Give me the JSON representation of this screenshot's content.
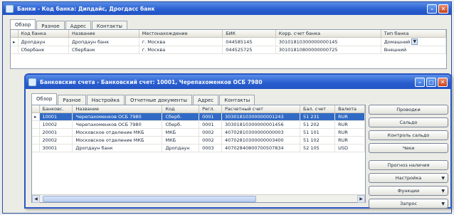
{
  "outer_window": {
    "title": "Банки - Код банка: Дипдайс, Дрогдасс банк",
    "tabs": [
      "Обзор",
      "Разное",
      "Адрес",
      "Контакты"
    ],
    "grid": {
      "columns": [
        "Код банка",
        "Название",
        "Местонахождение",
        "БИК",
        "Корр. счет банка",
        "Тип банка"
      ],
      "rows": [
        [
          "Дропдаун",
          "Дропдаун банк",
          "г. Москва",
          "044585145",
          "30101810300000000145",
          "Домашний"
        ],
        [
          "Сбербанк",
          "Сбербанк",
          "г. Москва",
          "044525725",
          "30101810800000000725",
          "Внешний"
        ]
      ]
    }
  },
  "inner_window": {
    "title": "Банковские счета - Банковский счет: 10001, Черепахоменков ОСБ 7980",
    "tabs": [
      "Обзор",
      "Разное",
      "Настройка",
      "Отчетные документы",
      "Адрес",
      "Контакты"
    ],
    "grid": {
      "columns": [
        "Банковс.",
        "Название",
        "Код",
        "Регл.",
        "Расчетный счет",
        "Бал. счет",
        "Валюта"
      ],
      "rows": [
        [
          "10001",
          "Черепахоменков ОСБ 7980",
          "Сберб.",
          "0001",
          "30301810300000001243",
          "51 231",
          "RUR"
        ],
        [
          "10002",
          "Черепахоменков ОСБ 7980",
          "Сберб.",
          "0001",
          "30301810300000001456",
          "51 202",
          "RUR"
        ],
        [
          "20001",
          "Московское отделение МКБ",
          "МКБ",
          "0002",
          "40702810300000000003",
          "51 101",
          "RUR"
        ],
        [
          "20002",
          "Московское отделение МКБ",
          "МКБ",
          "0002",
          "40702810300000003400",
          "51 102",
          "RUR"
        ],
        [
          "30001",
          "Дропдаун банк",
          "Дропдаун",
          "0003",
          "40702840800700507834",
          "52 105",
          "USD"
        ]
      ]
    },
    "buttons": [
      {
        "label": "Проводки",
        "menu": false
      },
      {
        "label": "Сальдо",
        "menu": false
      },
      {
        "label": "Контроль сальдо",
        "menu": false
      },
      {
        "label": "Чеки",
        "menu": false
      },
      {
        "label": "Прогноз наличия",
        "menu": false
      },
      {
        "label": "Настройка",
        "menu": true
      },
      {
        "label": "Функции",
        "menu": true
      },
      {
        "label": "Запрос",
        "menu": true
      }
    ]
  },
  "icons": {
    "window_min": "minimize-icon",
    "window_max": "maximize-icon",
    "window_close": "close-icon",
    "dropdown": "chevron-down-icon"
  },
  "colors": {
    "title_bar": "#2a5fd0",
    "selection": "#316ac5"
  }
}
